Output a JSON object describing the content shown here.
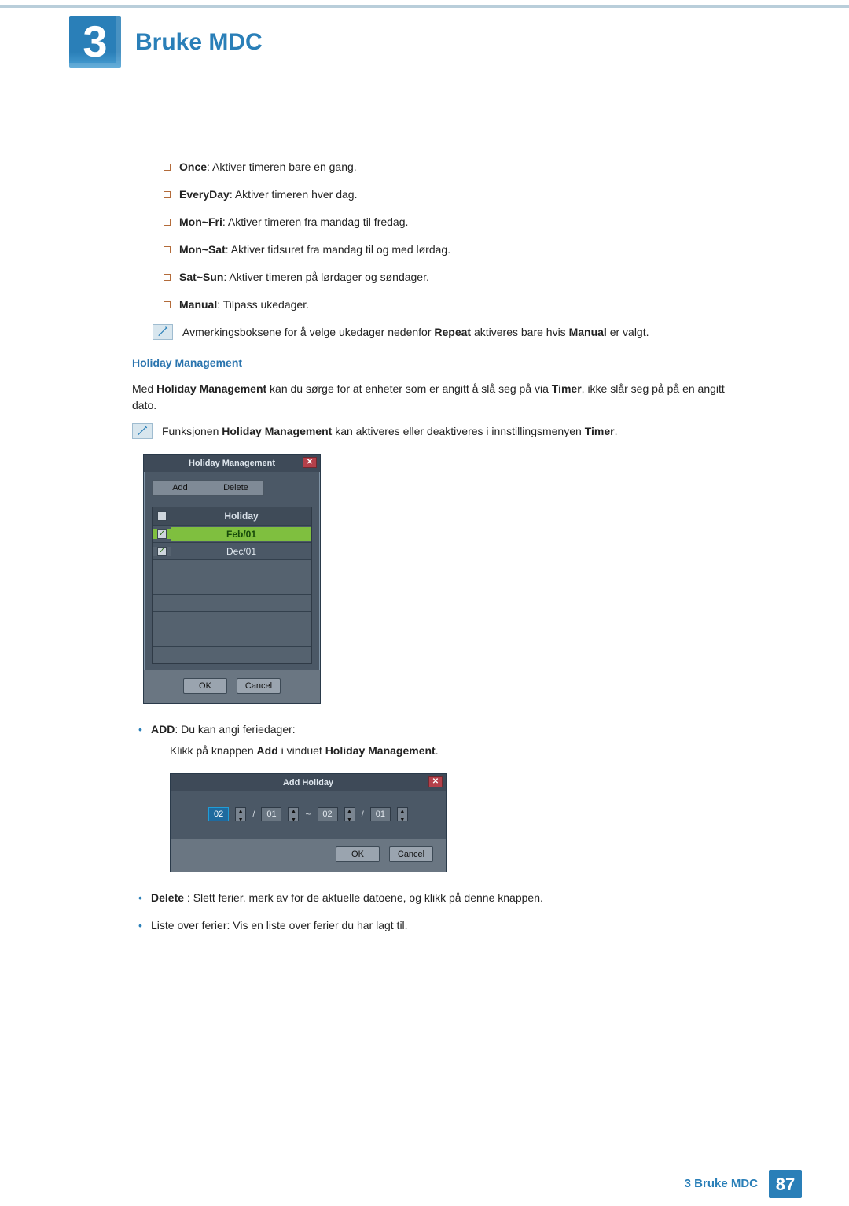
{
  "chapter": {
    "number": "3",
    "title": "Bruke MDC"
  },
  "repeat_options": [
    {
      "term": "Once",
      "desc": ": Aktiver timeren bare en gang."
    },
    {
      "term": "EveryDay",
      "desc": ": Aktiver timeren hver dag."
    },
    {
      "term": "Mon~Fri",
      "desc": ": Aktiver timeren fra mandag til fredag."
    },
    {
      "term": "Mon~Sat",
      "desc": ": Aktiver tidsuret fra mandag til og med lørdag."
    },
    {
      "term": "Sat~Sun",
      "desc": ": Aktiver timeren på lørdager og søndager."
    },
    {
      "term": "Manual",
      "desc": ": Tilpass ukedager."
    }
  ],
  "note1": {
    "pre": "Avmerkingsboksene for å velge ukedager nedenfor ",
    "b1": "Repeat",
    "mid": " aktiveres bare hvis ",
    "b2": "Manual",
    "post": " er valgt."
  },
  "hm_heading": "Holiday Management",
  "hm_para": {
    "pre": "Med ",
    "b1": "Holiday Management",
    "mid": " kan du sørge for at enheter som er angitt å slå seg på via ",
    "b2": "Timer",
    "post": ", ikke slår seg på på en angitt dato."
  },
  "note2": {
    "pre": "Funksjonen ",
    "b1": "Holiday Management",
    "mid": " kan aktiveres eller deaktiveres i innstillingsmenyen ",
    "b2": "Timer",
    "post": "."
  },
  "dialog1": {
    "title": "Holiday Management",
    "tabs": [
      "Add",
      "Delete"
    ],
    "header": "Holiday",
    "rows": [
      {
        "val": "Feb/01",
        "checked": true,
        "selected": true
      },
      {
        "val": "Dec/01",
        "checked": true,
        "selected": false
      }
    ],
    "ok": "OK",
    "cancel": "Cancel"
  },
  "after_dialog1": [
    {
      "term": "ADD",
      "desc": ": Du kan angi feriedager:"
    }
  ],
  "sub_after_add": {
    "pre": "Klikk på knappen ",
    "b1": "Add",
    "mid": " i vinduet ",
    "b2": "Holiday Management",
    "post": "."
  },
  "dialog2": {
    "title": "Add Holiday",
    "v1": "02",
    "v2": "01",
    "sep1": "/",
    "tilde": "~",
    "v3": "02",
    "sep2": "/",
    "v4": "01",
    "ok": "OK",
    "cancel": "Cancel"
  },
  "after_dialog2": [
    {
      "term": "Delete",
      "desc": " : Slett ferier. merk av for de aktuelle datoene, og klikk på denne knappen."
    },
    {
      "term_plain": "Liste over ferier: Vis en liste over ferier du har lagt til."
    }
  ],
  "footer": {
    "text": "3 Bruke MDC",
    "page": "87"
  }
}
